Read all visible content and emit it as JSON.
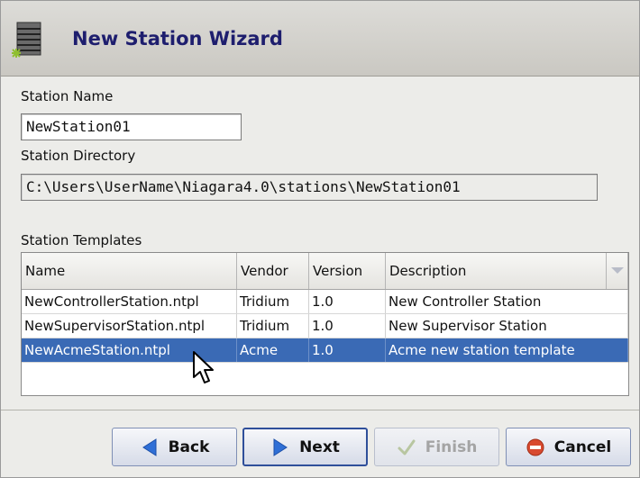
{
  "window": {
    "title": "New Station Wizard",
    "icon": "station-wizard-icon"
  },
  "form": {
    "station_name_label": "Station Name",
    "station_name_value": "NewStation01",
    "station_directory_label": "Station Directory",
    "station_directory_value": "C:\\Users\\UserName\\Niagara4.0\\stations\\NewStation01",
    "templates_label": "Station Templates"
  },
  "templates_table": {
    "columns": [
      "Name",
      "Vendor",
      "Version",
      "Description"
    ],
    "rows": [
      {
        "name": "NewControllerStation.ntpl",
        "vendor": "Tridium",
        "version": "1.0",
        "description": "New Controller Station",
        "selected": false
      },
      {
        "name": "NewSupervisorStation.ntpl",
        "vendor": "Tridium",
        "version": "1.0",
        "description": "New Supervisor Station",
        "selected": false
      },
      {
        "name": "NewAcmeStation.ntpl",
        "vendor": "Acme",
        "version": "1.0",
        "description": "Acme new station template",
        "selected": true
      }
    ]
  },
  "buttons": {
    "back": "Back",
    "next": "Next",
    "finish": "Finish",
    "cancel": "Cancel"
  },
  "colors": {
    "selection": "#3a6ab5",
    "title": "#1e1e6e",
    "arrow_blue": "#2f6fd6",
    "cancel_red": "#d84a2f"
  }
}
